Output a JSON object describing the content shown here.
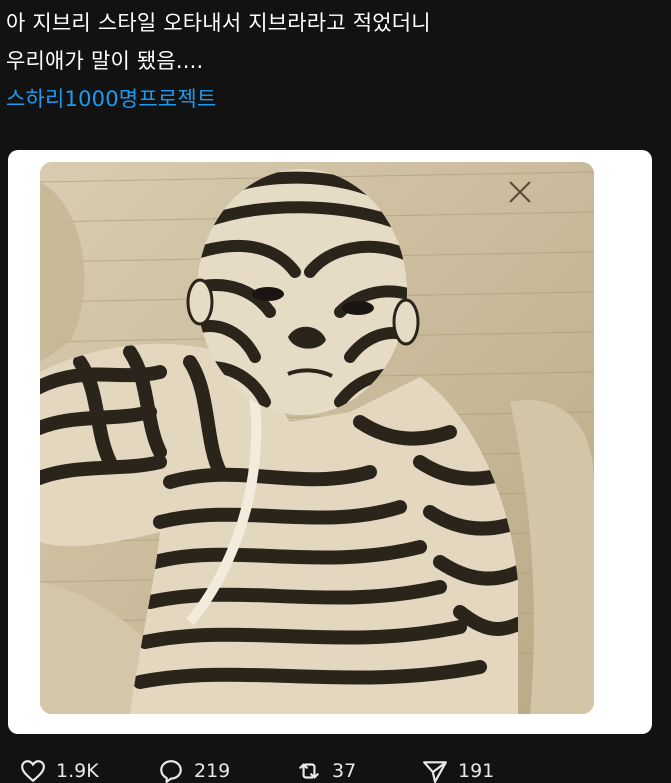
{
  "tweet": {
    "line1": "아 지브리 스타일 오타내서 지브라라고 적었더니",
    "line2": "우리애가 말이 됐음....",
    "hashtag": "스하리1000명프로젝트"
  },
  "media": {
    "subject": "sepia sketch of a baby painted with zebra stripes"
  },
  "actions": {
    "likes": {
      "icon": "heart-icon",
      "count": "1.9K"
    },
    "replies": {
      "icon": "reply-icon",
      "count": "219"
    },
    "retweets": {
      "icon": "retweet-icon",
      "count": "37"
    },
    "shares": {
      "icon": "share-icon",
      "count": "191"
    }
  },
  "colors": {
    "background": "#121212",
    "text": "#ffffff",
    "hashtag": "#1d9bf0",
    "card": "#ffffff",
    "sepia": "#cbbb9c"
  }
}
